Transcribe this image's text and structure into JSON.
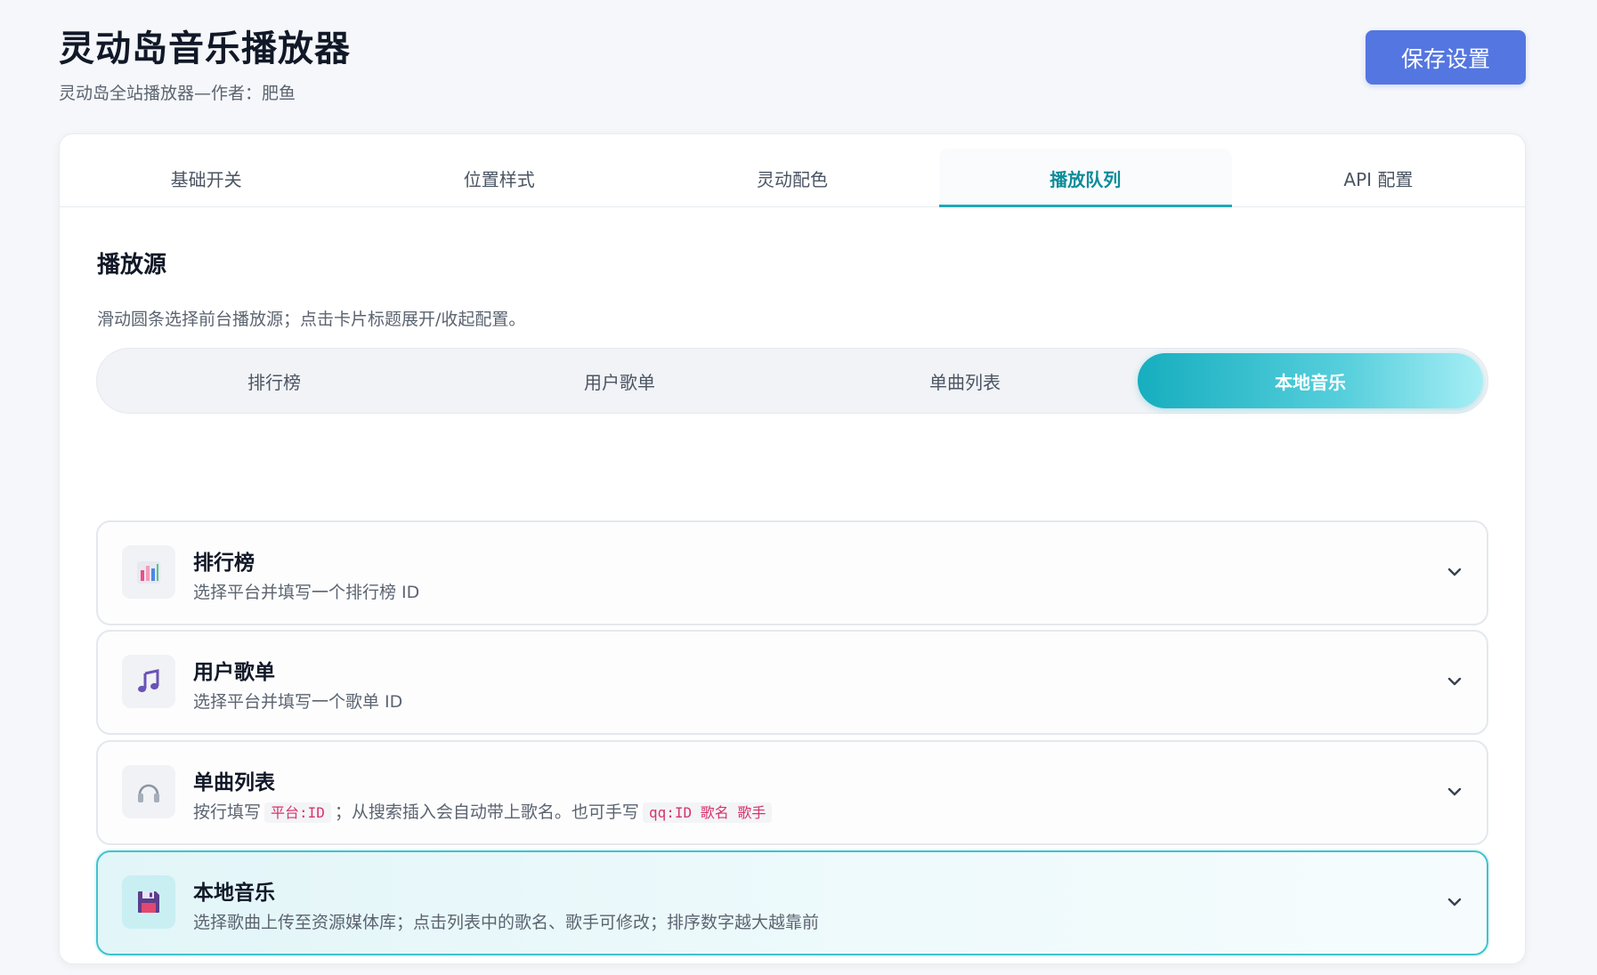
{
  "header": {
    "title": "灵动岛音乐播放器",
    "subtitle": "灵动岛全站播放器—作者：肥鱼",
    "save_label": "保存设置"
  },
  "tabs": [
    {
      "label": "基础开关",
      "active": false
    },
    {
      "label": "位置样式",
      "active": false
    },
    {
      "label": "灵动配色",
      "active": false
    },
    {
      "label": "播放队列",
      "active": true
    },
    {
      "label": "API 配置",
      "active": false
    }
  ],
  "section": {
    "title": "播放源",
    "desc": "滑动圆条选择前台播放源；点击卡片标题展开/收起配置。"
  },
  "segments": [
    {
      "label": "排行榜",
      "active": false
    },
    {
      "label": "用户歌单",
      "active": false
    },
    {
      "label": "单曲列表",
      "active": false
    },
    {
      "label": "本地音乐",
      "active": true
    }
  ],
  "cards": [
    {
      "title": "排行榜",
      "desc": "选择平台并填写一个排行榜 ID",
      "icon": "bar-chart-icon"
    },
    {
      "title": "用户歌单",
      "desc": "选择平台并填写一个歌单 ID",
      "icon": "music-note-icon"
    },
    {
      "title": "单曲列表",
      "desc_a": "按行填写",
      "code_a": "平台:ID",
      "desc_b": "；从搜索插入会自动带上歌名。也可手写",
      "code_b": "qq:ID 歌名 歌手",
      "icon": "headphones-icon"
    },
    {
      "title": "本地音乐",
      "desc": "选择歌曲上传至资源媒体库；点击列表中的歌名、歌手可修改；排序数字越大越靠前",
      "icon": "floppy-disk-icon",
      "active": true
    }
  ],
  "colors": {
    "accent": "#1ba9b8",
    "button": "#5476e0",
    "code_text": "#d6336c"
  }
}
